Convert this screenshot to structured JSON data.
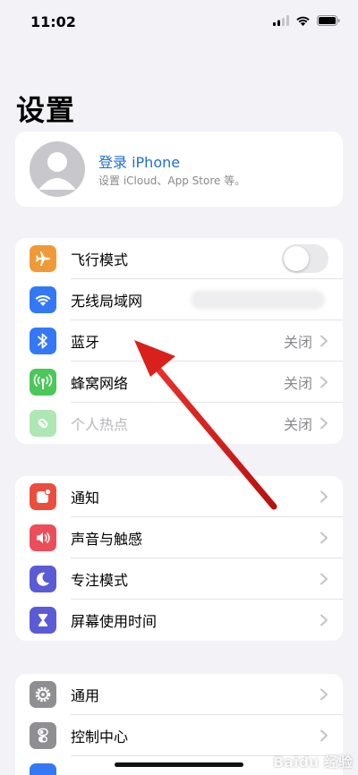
{
  "status": {
    "time": "11:02"
  },
  "page_title": "设置",
  "profile": {
    "title": "登录 iPhone",
    "subtitle": "设置 iCloud、App Store 等。"
  },
  "connectivity": [
    {
      "label": "飞行模式",
      "icon": "airplane-icon",
      "color": "#f09a37",
      "toggle": false
    },
    {
      "label": "无线局域网",
      "icon": "wifi-icon",
      "color": "#3478f6",
      "value": ""
    },
    {
      "label": "蓝牙",
      "icon": "bluetooth-icon",
      "color": "#3478f6",
      "value": "关闭"
    },
    {
      "label": "蜂窝网络",
      "icon": "cellular-icon",
      "color": "#4cc759",
      "value": "关闭"
    },
    {
      "label": "个人热点",
      "icon": "hotspot-icon",
      "color": "#4cc759",
      "value": "关闭",
      "dimmed": true
    }
  ],
  "notifications": [
    {
      "label": "通知",
      "icon": "notification-bell-icon",
      "color": "#eb4e3d"
    },
    {
      "label": "声音与触感",
      "icon": "sound-icon",
      "color": "#eb4e5a"
    },
    {
      "label": "专注模式",
      "icon": "moon-icon",
      "color": "#5b5bd6"
    },
    {
      "label": "屏幕使用时间",
      "icon": "hourglass-icon",
      "color": "#5b5bd6"
    }
  ],
  "general": [
    {
      "label": "通用",
      "icon": "gear-icon",
      "color": "#8e8e93"
    },
    {
      "label": "控制中心",
      "icon": "toggles-icon",
      "color": "#8e8e93"
    }
  ],
  "annotation": {
    "arrow_color": "#d9201c"
  },
  "watermark": "Baidu 经验"
}
